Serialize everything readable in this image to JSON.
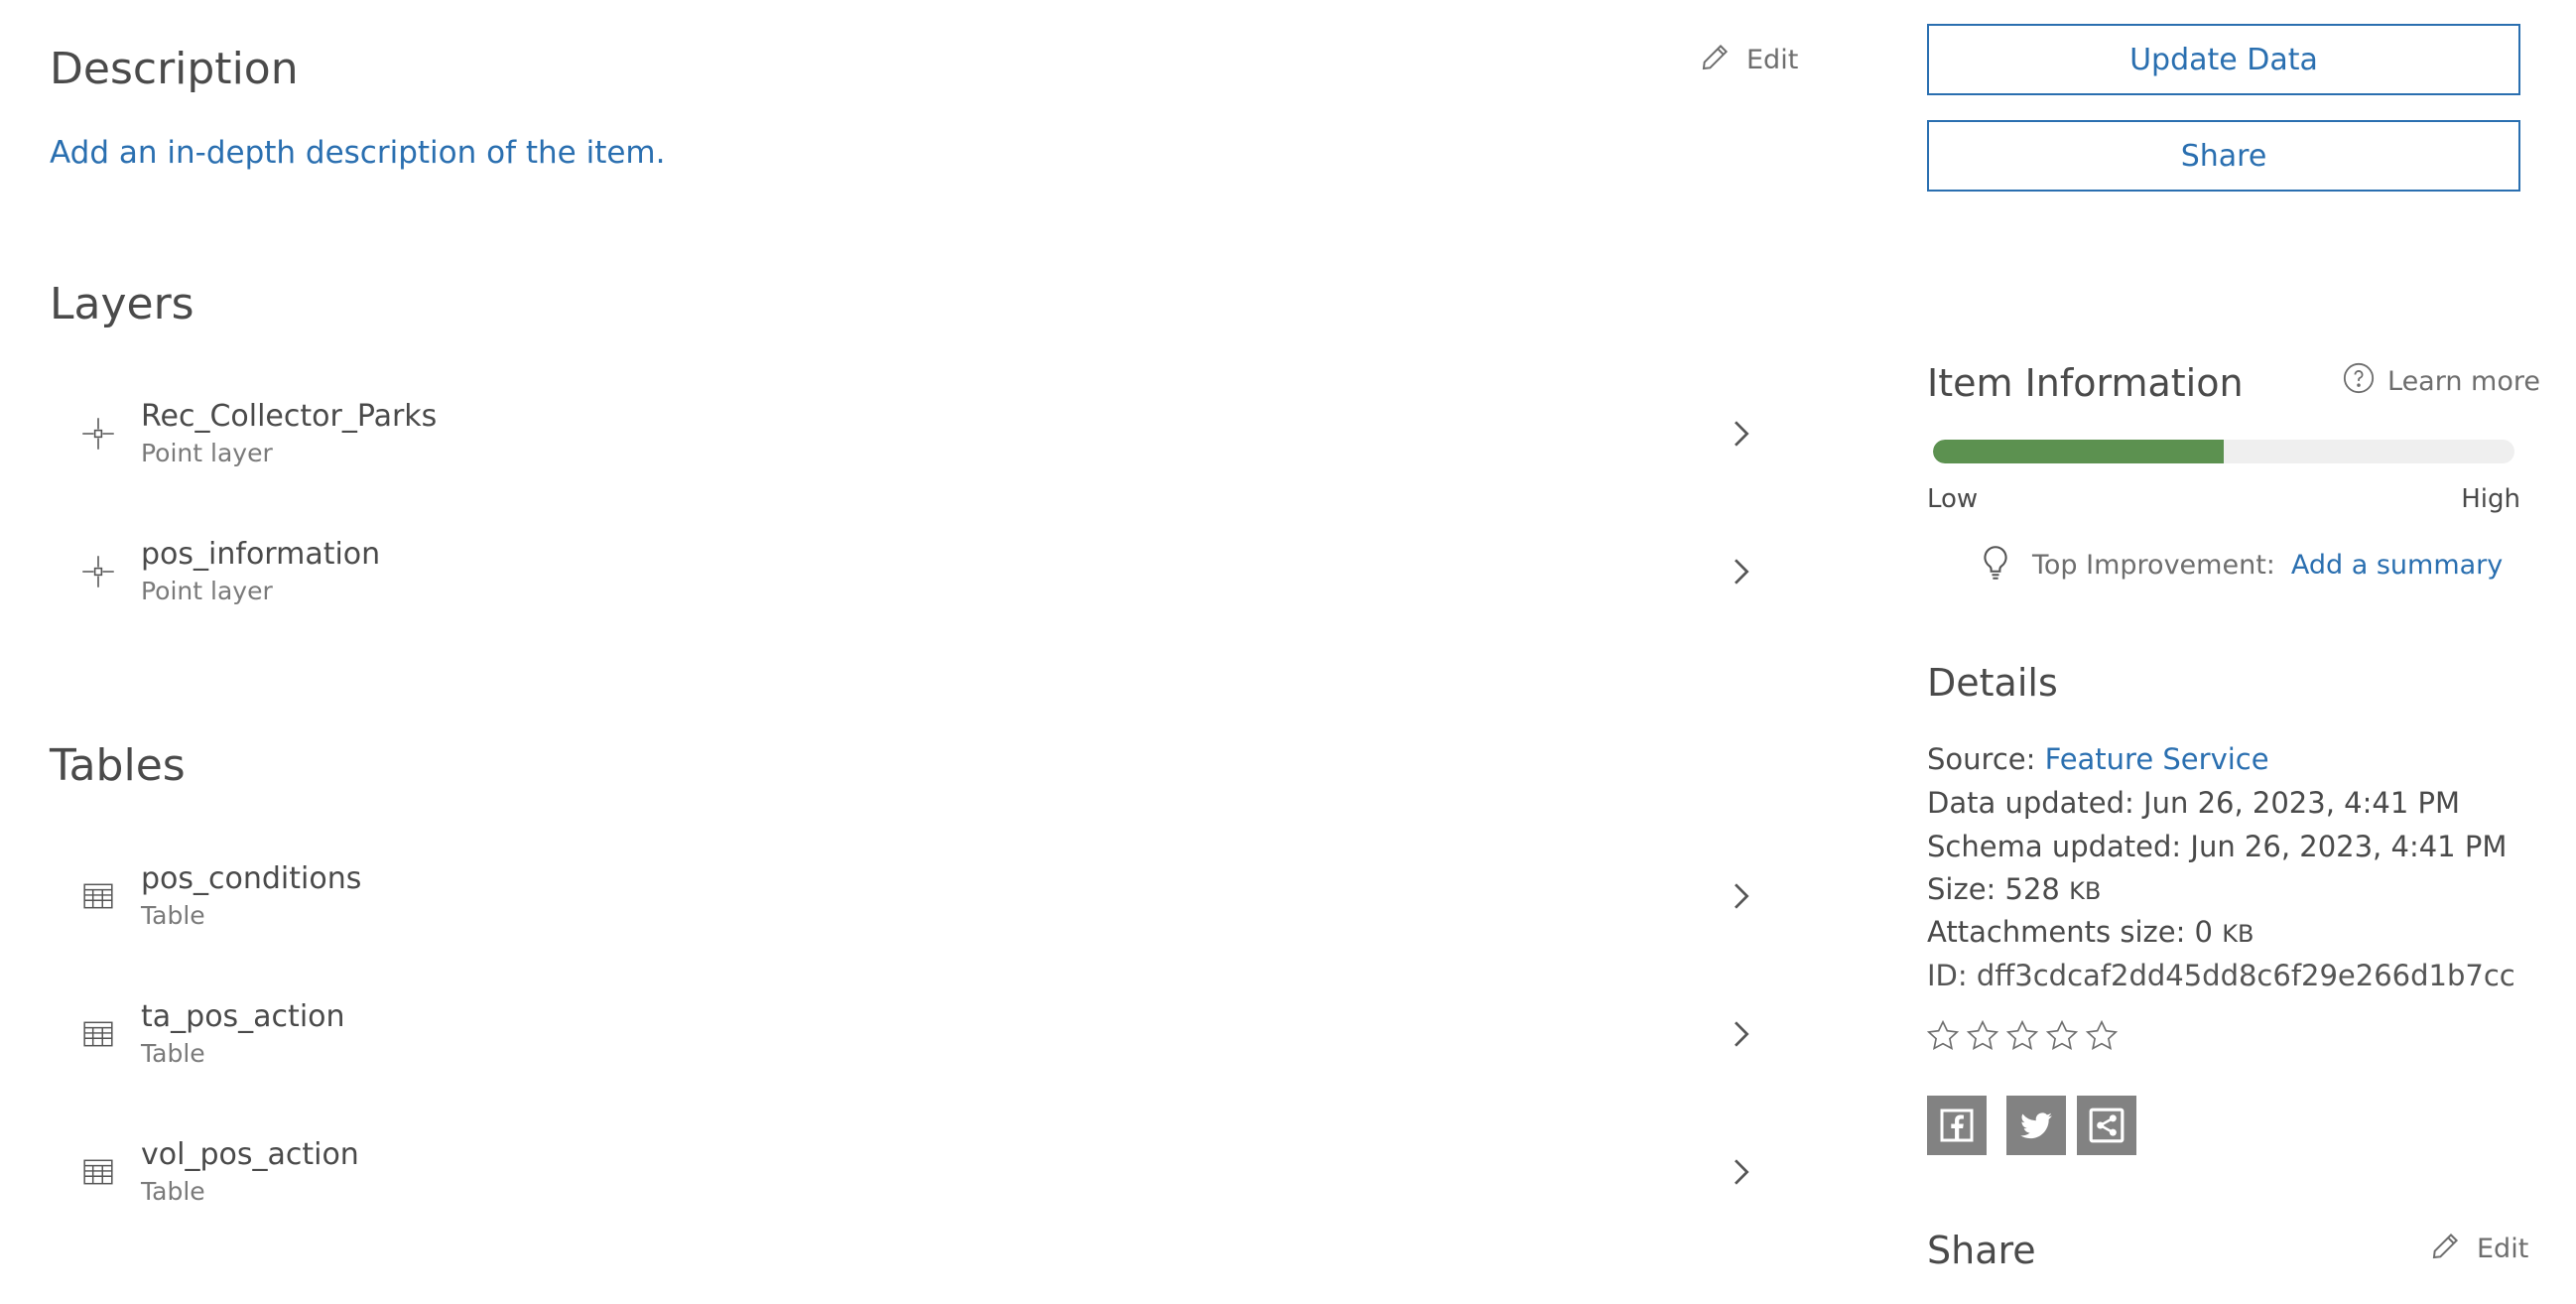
{
  "description": {
    "heading": "Description",
    "edit_label": "Edit",
    "add_link": "Add an in-depth description of the item."
  },
  "layers": {
    "heading": "Layers",
    "items": [
      {
        "title": "Rec_Collector_Parks",
        "type": "Point layer"
      },
      {
        "title": "pos_information",
        "type": "Point layer"
      }
    ]
  },
  "tables": {
    "heading": "Tables",
    "items": [
      {
        "title": "pos_conditions",
        "type": "Table"
      },
      {
        "title": "ta_pos_action",
        "type": "Table"
      },
      {
        "title": "vol_pos_action",
        "type": "Table"
      }
    ]
  },
  "actions": {
    "update_data_label": "Update Data",
    "share_label": "Share"
  },
  "item_information": {
    "heading": "Item Information",
    "learn_more_label": "Learn more",
    "progress": 0.5,
    "low_label": "Low",
    "high_label": "High",
    "top_improvement_label": "Top Improvement:",
    "top_improvement_link": "Add a summary"
  },
  "details": {
    "heading": "Details",
    "source_label": "Source:",
    "source_value": "Feature Service",
    "data_updated": "Data updated: Jun 26, 2023, 4:41 PM",
    "schema_updated": "Schema updated: Jun 26, 2023, 4:41 PM",
    "size_label": "Size: 528",
    "size_unit": "KB",
    "attachments_label": "Attachments size: 0",
    "attachments_unit": "KB",
    "id_text": "ID: dff3cdcaf2dd45dd8c6f29e266d1b7cc",
    "rating": 0
  },
  "share_section": {
    "heading": "Share",
    "edit_label": "Edit"
  },
  "colors": {
    "accent": "#2a6fb0",
    "progress_fill": "#5c9150",
    "progress_track": "#efefef",
    "social_bg": "#828282"
  }
}
